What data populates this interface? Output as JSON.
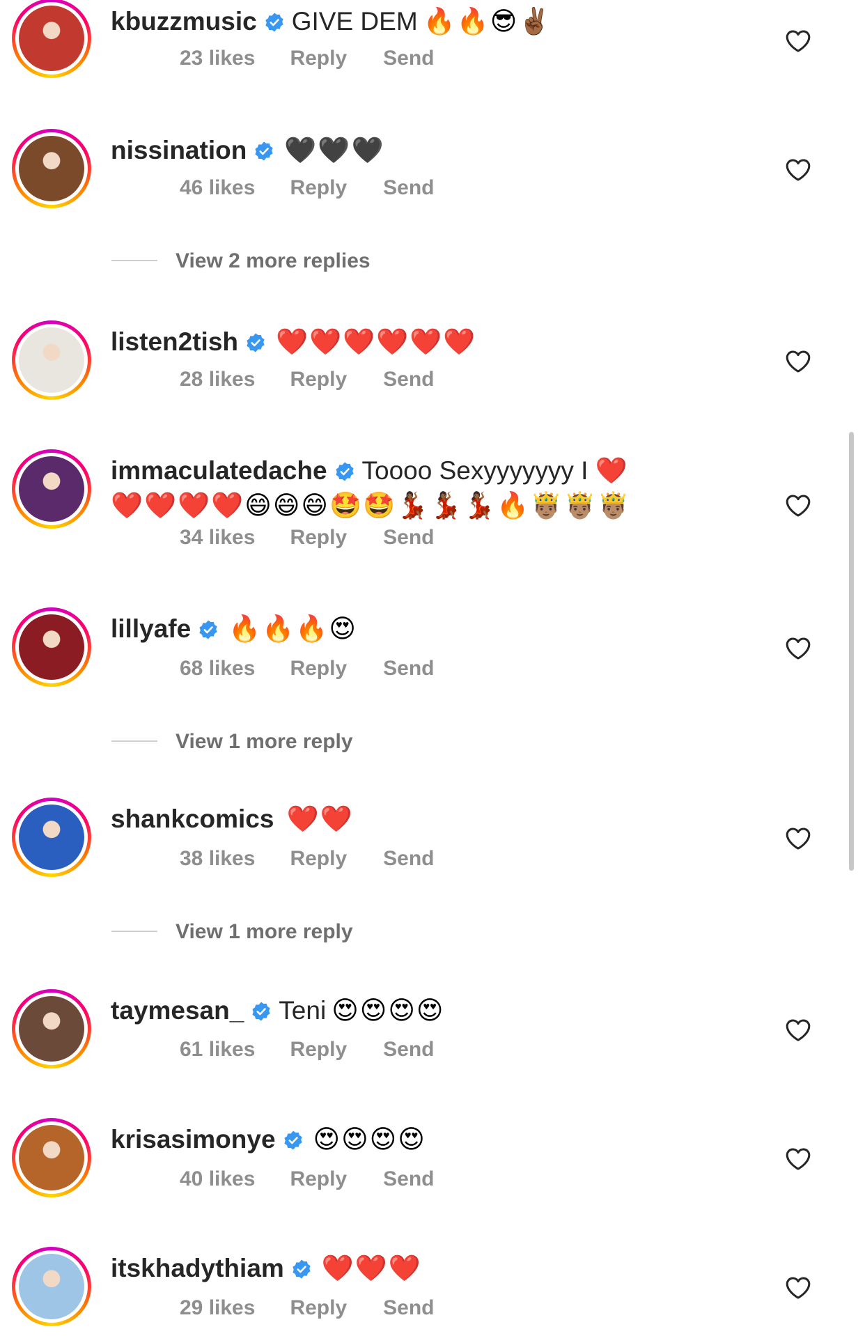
{
  "comments": [
    {
      "username": "kbuzzmusic",
      "verified": true,
      "text": "GIVE DEM",
      "emojis": "🔥🔥😎✌🏾",
      "likes": "23 likes",
      "reply": "Reply",
      "send": "Send",
      "avatar_color": "#c2392f"
    },
    {
      "username": "nissination",
      "verified": true,
      "text": "",
      "emojis": "🖤🖤🖤",
      "likes": "46 likes",
      "reply": "Reply",
      "send": "Send",
      "avatar_color": "#7a4a2a"
    },
    {
      "username": "listen2tish",
      "verified": true,
      "text": "",
      "emojis": "❤️❤️❤️❤️❤️❤️",
      "likes": "28 likes",
      "reply": "Reply",
      "send": "Send",
      "avatar_color": "#e9e6df"
    },
    {
      "username": "immaculatedache",
      "verified": true,
      "text": "Toooo Sexyyyyyyy I ❤️",
      "emojis": "❤️❤️❤️❤️😄😄😄🤩🤩💃🏾💃🏾💃🏾🔥🤴🏽🤴🏽🤴🏽",
      "likes": "34 likes",
      "reply": "Reply",
      "send": "Send",
      "avatar_color": "#5a2a6a"
    },
    {
      "username": "lillyafe",
      "verified": true,
      "text": "",
      "emojis": "🔥🔥🔥😍",
      "likes": "68 likes",
      "reply": "Reply",
      "send": "Send",
      "avatar_color": "#8b1c24"
    },
    {
      "username": "shankcomics",
      "verified": false,
      "text": "",
      "emojis": "❤️❤️",
      "likes": "38 likes",
      "reply": "Reply",
      "send": "Send",
      "avatar_color": "#2a5fbf"
    },
    {
      "username": "taymesan_",
      "verified": true,
      "text": "Teni",
      "emojis": "😍😍😍😍",
      "likes": "61 likes",
      "reply": "Reply",
      "send": "Send",
      "avatar_color": "#6b4a3a"
    },
    {
      "username": "krisasimonye",
      "verified": true,
      "text": "",
      "emojis": "😍😍😍😍",
      "likes": "40 likes",
      "reply": "Reply",
      "send": "Send",
      "avatar_color": "#b5652a"
    },
    {
      "username": "itskhadythiam",
      "verified": true,
      "text": "",
      "emojis": "❤️❤️❤️",
      "likes": "29 likes",
      "reply": "Reply",
      "send": "Send",
      "avatar_color": "#9ec4e6"
    }
  ],
  "view_more": [
    {
      "label": "View 2 more replies"
    },
    {
      "label": "View 1 more reply"
    },
    {
      "label": "View 1 more reply"
    }
  ],
  "colors": {
    "verified_badge": "#3897f0",
    "meta_text": "#8e8e8e",
    "username": "#262626"
  },
  "icons": {
    "like": "heart-outline-icon",
    "verified": "verified-badge-icon"
  }
}
